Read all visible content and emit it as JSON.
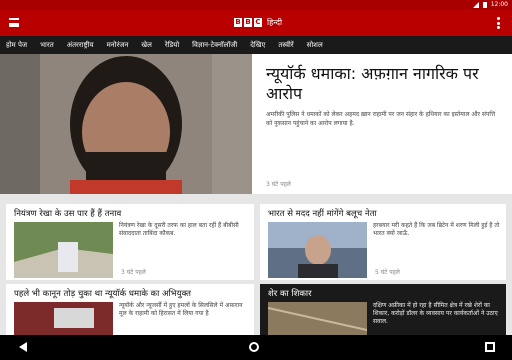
{
  "status_bar": {
    "time": "12:00"
  },
  "app": {
    "logo_letters": [
      "B",
      "B",
      "C"
    ],
    "edition": "हिन्दी"
  },
  "nav": [
    "होम पेज",
    "भारत",
    "अंतरराष्ट्रीय",
    "मनोरंजन",
    "खेल",
    "रेडियो",
    "विज्ञान-टेक्नॉलॉजी",
    "देखिए",
    "तस्वीरें",
    "सोशल"
  ],
  "hero": {
    "title": "न्यूयॉर्क धमाका: अफ़ग़ान नागरिक पर आरोप",
    "summary": "अमरीकी पुलिस ने धमाकों को लेकर अहमद ख़ान राहामी पर जन संहार के हथियार का इस्तेमाल और संपत्ति को नुकसान पहुंचाने का आरोप लगाया है.",
    "time": "3 घंटे पहले"
  },
  "cards": [
    {
      "title": "नियंत्रण रेखा के उस पार हैं हैं तनाव",
      "summary": "नियंत्रण रेखा के दूसरी तरफ का हाल बता रहीं हैं बीबीसी संवाददाता ताबिंदा कौकब.",
      "time": "3 घंटे पहले"
    },
    {
      "title": "भारत से मदद नहीं मांगेंगे बलूच नेता",
      "summary": "हरबयार मरी कहते हैं कि जब ब्रिटेन में शरण मिली हुई है तो भारत क्यों जाऊँ.",
      "time": "5 घंटे पहले"
    },
    {
      "title": "पहले भी कानून तोड़ चुका था न्यूयॉर्क धमाके का अभियुक्त",
      "summary": "न्यूयॉर्क और न्यूजर्सी में हुए हमलों के सिलसिले में अफ़ग़ान मूल के राहामी को हिरासत में लिया गया है",
      "time": ""
    },
    {
      "title": "शेर का शिकार",
      "summary": "दक्षिण अफ्रीका में हो रहा है सीमित क्षेत्र में रखे शेरों का शिकार, करोड़ों डॉलर के व्यवसाय पर कार्यकर्ताओं ने उठाए सवाल.",
      "time": ""
    }
  ]
}
